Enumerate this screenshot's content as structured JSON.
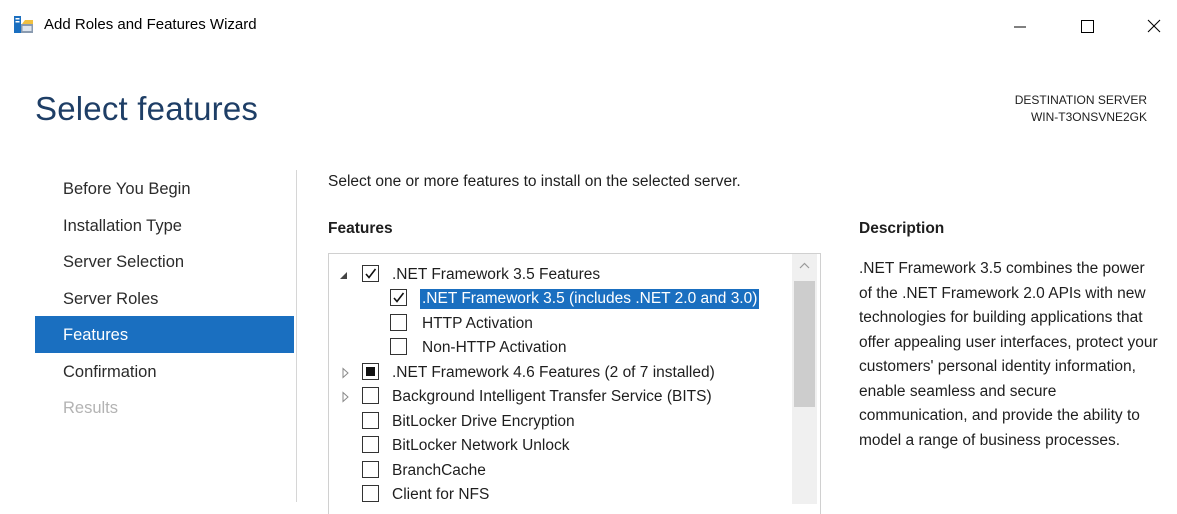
{
  "window": {
    "title": "Add Roles and Features Wizard",
    "minimize_icon": "minimize-icon",
    "maximize_icon": "maximize-icon",
    "close_icon": "close-icon"
  },
  "page": {
    "title": "Select features",
    "destination_label": "DESTINATION SERVER",
    "destination_server": "WIN-T3ONSVNE2GK"
  },
  "nav": {
    "items": [
      {
        "label": "Before You Begin",
        "state": "normal"
      },
      {
        "label": "Installation Type",
        "state": "normal"
      },
      {
        "label": "Server Selection",
        "state": "normal"
      },
      {
        "label": "Server Roles",
        "state": "normal"
      },
      {
        "label": "Features",
        "state": "active"
      },
      {
        "label": "Confirmation",
        "state": "normal"
      },
      {
        "label": "Results",
        "state": "disabled"
      }
    ]
  },
  "main": {
    "instructions": "Select one or more features to install on the selected server.",
    "features_heading": "Features",
    "features": [
      {
        "label": ".NET Framework 3.5 Features",
        "checked": "checked",
        "expander": "expanded",
        "indent": 0
      },
      {
        "label": ".NET Framework 3.5 (includes .NET 2.0 and 3.0)",
        "checked": "checked",
        "expander": "none",
        "indent": 1,
        "selected": true
      },
      {
        "label": "HTTP Activation",
        "checked": "unchecked",
        "expander": "none",
        "indent": 1
      },
      {
        "label": "Non-HTTP Activation",
        "checked": "unchecked",
        "expander": "none",
        "indent": 1
      },
      {
        "label": ".NET Framework 4.6 Features (2 of 7 installed)",
        "checked": "partial",
        "expander": "collapsed",
        "indent": 0
      },
      {
        "label": "Background Intelligent Transfer Service (BITS)",
        "checked": "unchecked",
        "expander": "collapsed",
        "indent": 0
      },
      {
        "label": "BitLocker Drive Encryption",
        "checked": "unchecked",
        "expander": "none",
        "indent": 0
      },
      {
        "label": "BitLocker Network Unlock",
        "checked": "unchecked",
        "expander": "none",
        "indent": 0
      },
      {
        "label": "BranchCache",
        "checked": "unchecked",
        "expander": "none",
        "indent": 0
      },
      {
        "label": "Client for NFS",
        "checked": "unchecked",
        "expander": "none",
        "indent": 0
      }
    ],
    "description_heading": "Description",
    "description": ".NET Framework 3.5 combines the power of the .NET Framework 2.0 APIs with new technologies for building applications that offer appealing user interfaces, protect your customers' personal identity information, enable seamless and secure communication, and provide the ability to model a range of business processes."
  },
  "colors": {
    "accent": "#1a6fc0",
    "title": "#1e3e66",
    "disabled_text": "#b3b3b3"
  }
}
